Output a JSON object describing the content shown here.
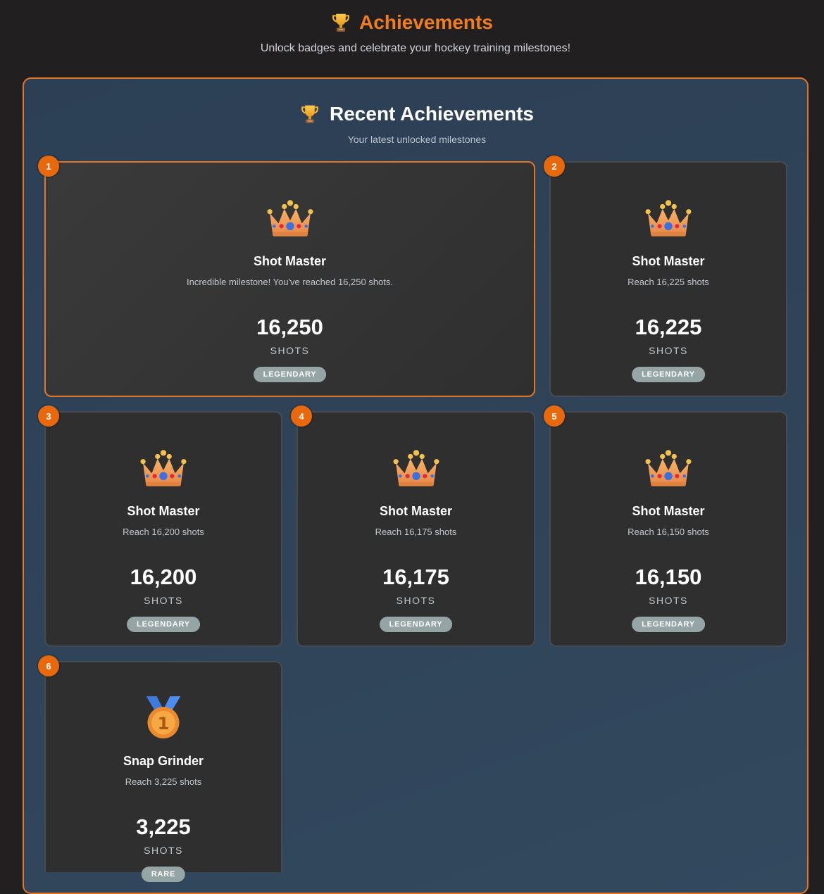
{
  "header": {
    "title": "Achievements",
    "subtitle": "Unlock badges and celebrate your hockey training milestones!",
    "icon": "trophy-icon"
  },
  "recent": {
    "title": "Recent Achievements",
    "subtitle": "Your latest unlocked milestones",
    "icon": "trophy-icon"
  },
  "colors": {
    "accent": "#e47524",
    "badge": "#e8680c",
    "tier_pill": "#95a5a6",
    "panel": "#2f4357",
    "card": "#2f2f2f"
  },
  "achievements": [
    {
      "rank": "1",
      "icon": "crown-icon",
      "name": "Shot Master",
      "description": "Incredible milestone! You've reached 16,250 shots.",
      "value": "16,250",
      "unit": "SHOTS",
      "tier": "LEGENDARY"
    },
    {
      "rank": "2",
      "icon": "crown-icon",
      "name": "Shot Master",
      "description": "Reach 16,225 shots",
      "value": "16,225",
      "unit": "SHOTS",
      "tier": "LEGENDARY"
    },
    {
      "rank": "3",
      "icon": "crown-icon",
      "name": "Shot Master",
      "description": "Reach 16,200 shots",
      "value": "16,200",
      "unit": "SHOTS",
      "tier": "LEGENDARY"
    },
    {
      "rank": "4",
      "icon": "crown-icon",
      "name": "Shot Master",
      "description": "Reach 16,175 shots",
      "value": "16,175",
      "unit": "SHOTS",
      "tier": "LEGENDARY"
    },
    {
      "rank": "5",
      "icon": "crown-icon",
      "name": "Shot Master",
      "description": "Reach 16,150 shots",
      "value": "16,150",
      "unit": "SHOTS",
      "tier": "LEGENDARY"
    },
    {
      "rank": "6",
      "icon": "medal-icon",
      "name": "Snap Grinder",
      "description": "Reach 3,225 shots",
      "value": "3,225",
      "unit": "SHOTS",
      "tier": "RARE"
    }
  ]
}
